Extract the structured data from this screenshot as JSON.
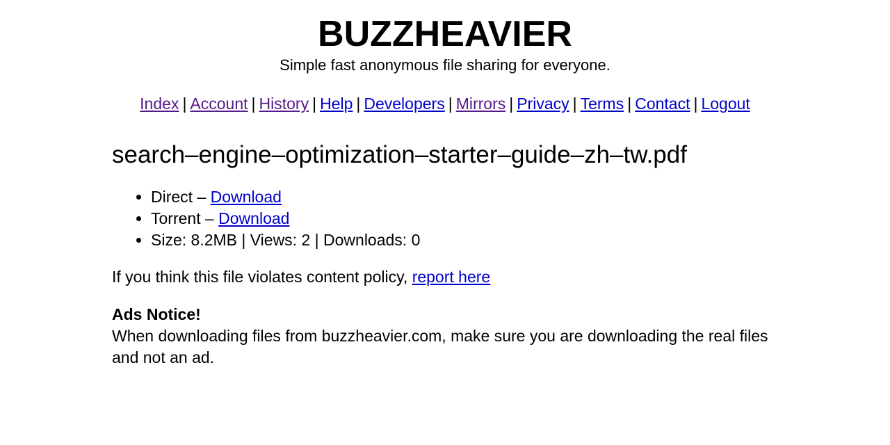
{
  "header": {
    "title": "BUZZHEAVIER",
    "tagline": "Simple fast anonymous file sharing for everyone."
  },
  "nav": {
    "separator": "|",
    "items": [
      {
        "label": "Index",
        "visited": true
      },
      {
        "label": "Account",
        "visited": true
      },
      {
        "label": "History",
        "visited": true
      },
      {
        "label": "Help",
        "visited": false
      },
      {
        "label": "Developers",
        "visited": false
      },
      {
        "label": "Mirrors",
        "visited": true
      },
      {
        "label": "Privacy",
        "visited": false
      },
      {
        "label": "Terms",
        "visited": false
      },
      {
        "label": "Contact",
        "visited": false
      },
      {
        "label": "Logout",
        "visited": false
      }
    ]
  },
  "file": {
    "name": "search–engine–optimization–starter–guide–zh–tw.pdf",
    "direct_label": "Direct – ",
    "direct_link": "Download",
    "torrent_label": "Torrent – ",
    "torrent_link": "Download",
    "stats": "Size: 8.2MB | Views: 2 | Downloads: 0",
    "size": "8.2MB",
    "views": 2,
    "downloads": 0
  },
  "policy": {
    "text": "If you think this file violates content policy, ",
    "link": "report here"
  },
  "ads_notice": {
    "title": "Ads Notice!",
    "text": "When downloading files from buzzheavier.com, make sure you are downloading the real files and not an ad."
  },
  "colors": {
    "link": "#0000cc",
    "visited_link": "#551a8b",
    "text": "#000000",
    "background": "#ffffff"
  }
}
